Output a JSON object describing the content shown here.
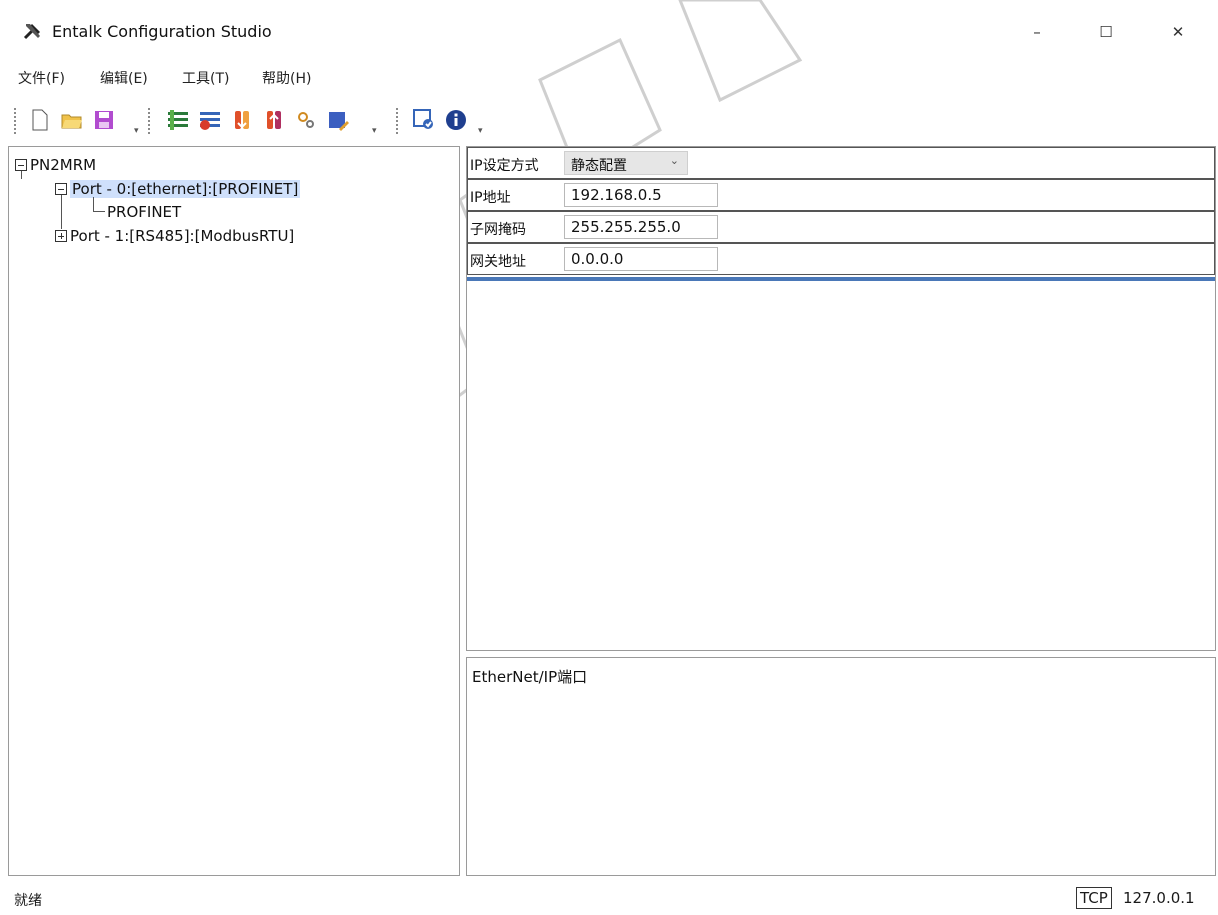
{
  "window": {
    "title": "Entalk Configuration Studio",
    "min_glyph": "–",
    "max_glyph": "☐",
    "close_glyph": "✕"
  },
  "menu": {
    "file": "文件(F)",
    "edit": "编辑(E)",
    "tools": "工具(T)",
    "help": "帮助(H)"
  },
  "toolbar": {
    "drop_glyph": "▾",
    "icons": [
      "new-file-icon",
      "open-folder-icon",
      "save-icon",
      "add-module-icon",
      "remove-module-icon",
      "upload-icon",
      "download-icon",
      "settings-icon",
      "edit-icon",
      "monitor-icon",
      "info-icon"
    ]
  },
  "tree": {
    "root": "PN2MRM",
    "port0": "Port - 0:[ethernet]:[PROFINET]",
    "port0_child": "PROFINET",
    "port1": "Port - 1:[RS485]:[ModbusRTU]"
  },
  "properties": {
    "ip_mode_label": "IP设定方式",
    "ip_mode_value": "静态配置",
    "ip_label": "IP地址",
    "ip_value": "192.168.0.5",
    "mask_label": "子网掩码",
    "mask_value": "255.255.255.0",
    "gateway_label": "网关地址",
    "gateway_value": "0.0.0.0"
  },
  "description": {
    "text": "EtherNet/IP端口"
  },
  "status": {
    "text": "就绪",
    "protocol": "TCP",
    "ip": "127.0.0.1"
  },
  "colors": {
    "selection": "#cfe0fb",
    "accent_line": "#4a78b8",
    "watermark": "#c8c8c8"
  }
}
